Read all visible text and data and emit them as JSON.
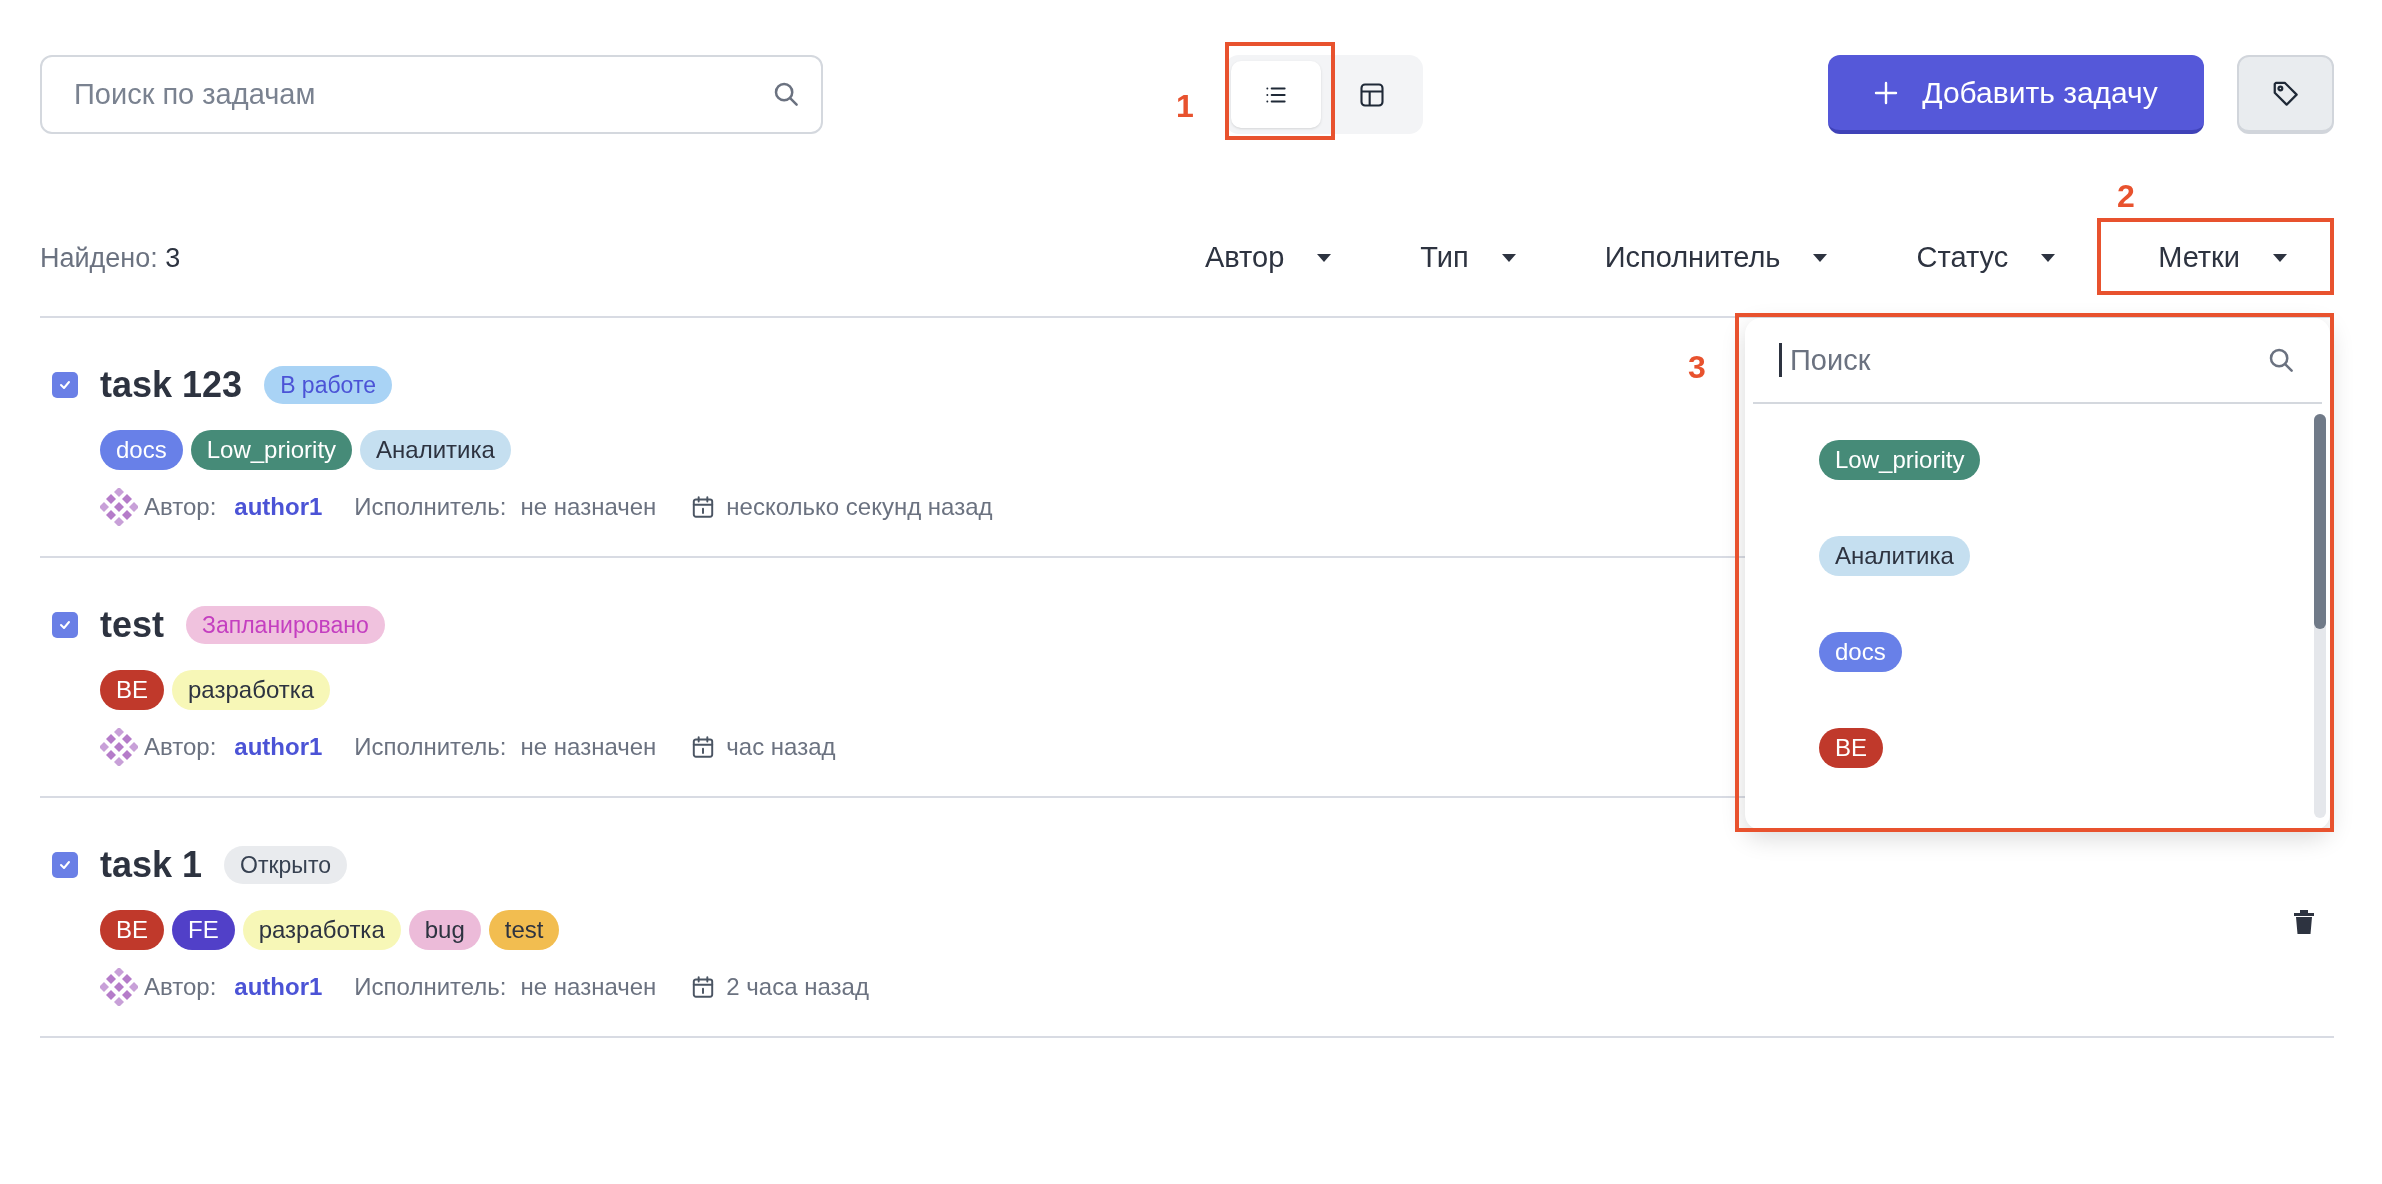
{
  "search": {
    "placeholder": "Поиск по задачам"
  },
  "view_toggle": [
    {
      "kind": "list",
      "selected": true
    },
    {
      "kind": "table",
      "selected": false
    }
  ],
  "add_button": {
    "label": "Добавить задачу"
  },
  "found": {
    "label": "Найдено:",
    "count": "3"
  },
  "filters": [
    {
      "label": "Автор"
    },
    {
      "label": "Тип"
    },
    {
      "label": "Исполнитель"
    },
    {
      "label": "Статус"
    },
    {
      "label": "Метки"
    }
  ],
  "tasks": [
    {
      "title": "task 123",
      "checked": true,
      "status": {
        "label": "В работе",
        "kind": "in_progress"
      },
      "tags": [
        {
          "label": "docs",
          "color": "#6880e8"
        },
        {
          "label": "Low_priority",
          "color": "#468b78"
        },
        {
          "label": "Аналитика",
          "color": "#c5dff0"
        }
      ],
      "author_label": "Автор:",
      "author": "author1",
      "assignee_label": "Исполнитель:",
      "assignee": "не назначен",
      "time": "несколько секунд назад"
    },
    {
      "title": "test",
      "checked": true,
      "status": {
        "label": "Запланировано",
        "kind": "planned"
      },
      "tags": [
        {
          "label": "BE",
          "color": "#c0392b"
        },
        {
          "label": "разработка",
          "color": "#f7f7b7"
        }
      ],
      "author_label": "Автор:",
      "author": "author1",
      "assignee_label": "Исполнитель:",
      "assignee": "не назначен",
      "time": "час назад"
    },
    {
      "title": "task 1",
      "checked": true,
      "status": {
        "label": "Открыто",
        "kind": "open"
      },
      "tags": [
        {
          "label": "BE",
          "color": "#c0392b"
        },
        {
          "label": "FE",
          "color": "#5140c8"
        },
        {
          "label": "разработка",
          "color": "#f7f7b7"
        },
        {
          "label": "bug",
          "color": "#ecbbd9"
        },
        {
          "label": "test",
          "color": "#f2bd50"
        }
      ],
      "author_label": "Автор:",
      "author": "author1",
      "assignee_label": "Исполнитель:",
      "assignee": "не назначен",
      "time": "2 часа назад"
    }
  ],
  "tag_dropdown": {
    "placeholder": "Поиск",
    "focused": true,
    "items": [
      {
        "label": "Low_priority",
        "color": "#468b78"
      },
      {
        "label": "Аналитика",
        "color": "#c5dff0"
      },
      {
        "label": "docs",
        "color": "#6880e8"
      },
      {
        "label": "BE",
        "color": "#c0392b"
      }
    ]
  },
  "annotations": [
    {
      "label": "1"
    },
    {
      "label": "2"
    },
    {
      "label": "3"
    }
  ]
}
